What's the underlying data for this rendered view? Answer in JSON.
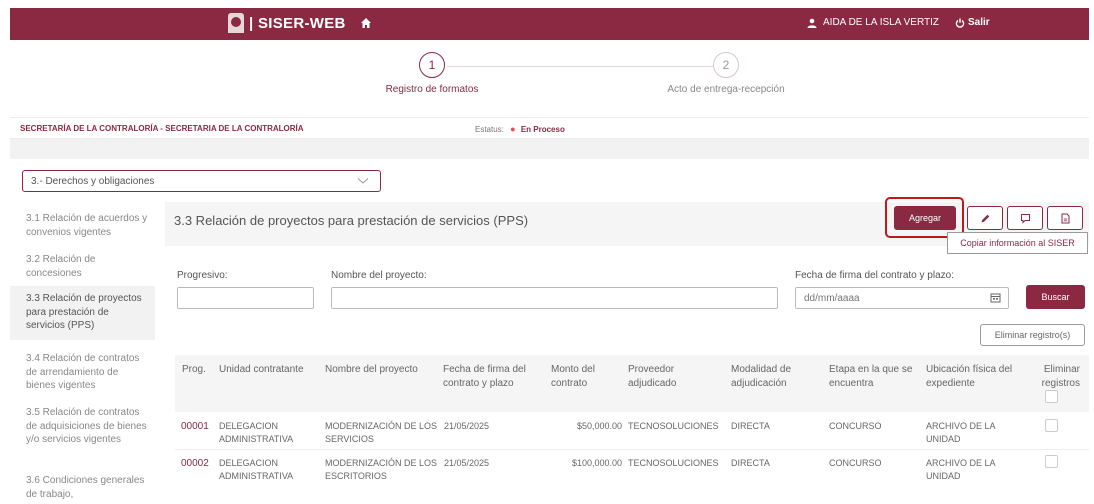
{
  "header": {
    "app_name": "| SISER-WEB",
    "user_name": "AIDA DE LA ISLA VERTIZ",
    "logout_label": "Salir"
  },
  "stepper": {
    "steps": [
      {
        "number": "1",
        "label": "Registro de formatos"
      },
      {
        "number": "2",
        "label": "Acto de entrega-recepción"
      }
    ]
  },
  "status_bar": {
    "department": "SECRETARÍA DE LA CONTRALORÍA - SECRETARIA DE LA CONTRALORÍA",
    "status_label": "Estatus:",
    "status_value": "En Proceso"
  },
  "section_select": {
    "selected": "3.- Derechos y obligaciones"
  },
  "sidebar": {
    "items": [
      {
        "label": "3.1 Relación de acuerdos y convenios vigentes"
      },
      {
        "label": "3.2 Relación de concesiones"
      },
      {
        "label": "3.3 Relación de proyectos para prestación de servicios (PPS)"
      },
      {
        "label": "3.4 Relación de contratos de arrendamiento de bienes vigentes"
      },
      {
        "label": "3.5 Relación de contratos de adquisiciones de bienes y/o servicios vigentes"
      },
      {
        "label": "3.6 Condiciones generales de trabajo,"
      }
    ]
  },
  "main": {
    "title": "3.3 Relación de proyectos para prestación de servicios (PPS)",
    "add_label": "Agregar",
    "copy_label": "Copiar información al SISER",
    "search_label": "Buscar",
    "delete_label": "Eliminar registro(s)"
  },
  "filters": {
    "progresivo_label": "Progresivo:",
    "progresivo_value": "",
    "nombre_label": "Nombre del proyecto:",
    "nombre_value": "",
    "fecha_label": "Fecha de firma del contrato y plazo:",
    "fecha_placeholder": "dd/mm/aaaa"
  },
  "table": {
    "columns": [
      "Prog.",
      "Unidad contratante",
      "Nombre del proyecto",
      "Fecha de firma del contrato y plazo",
      "Monto del contrato",
      "Proveedor adjudicado",
      "Modalidad de adjudicación",
      "Etapa en la que se encuentra",
      "Ubicación física del expediente",
      "Eliminar registros"
    ],
    "rows": [
      {
        "prog": "00001",
        "unidad": "DELEGACION ADMINISTRATIVA",
        "nombre": "MODERNIZACIÓN DE LOS SERVICIOS",
        "fecha": "21/05/2025",
        "monto": "$50,000.00",
        "proveedor": "TECNOSOLUCIONES",
        "modalidad": "DIRECTA",
        "etapa": "CONCURSO",
        "ubicacion": "ARCHIVO DE LA UNIDAD"
      },
      {
        "prog": "00002",
        "unidad": "DELEGACION ADMINISTRATIVA",
        "nombre": "MODERNIZACIÓN DE LOS ESCRITORIOS",
        "fecha": "21/05/2025",
        "monto": "$100,000.00",
        "proveedor": "TECNOSOLUCIONES",
        "modalidad": "DIRECTA",
        "etapa": "CONCURSO",
        "ubicacion": "ARCHIVO DE LA UNIDAD"
      }
    ]
  },
  "colors": {
    "brand": "#8b2942",
    "highlight": "#c01818",
    "status_dot": "#e05050"
  }
}
